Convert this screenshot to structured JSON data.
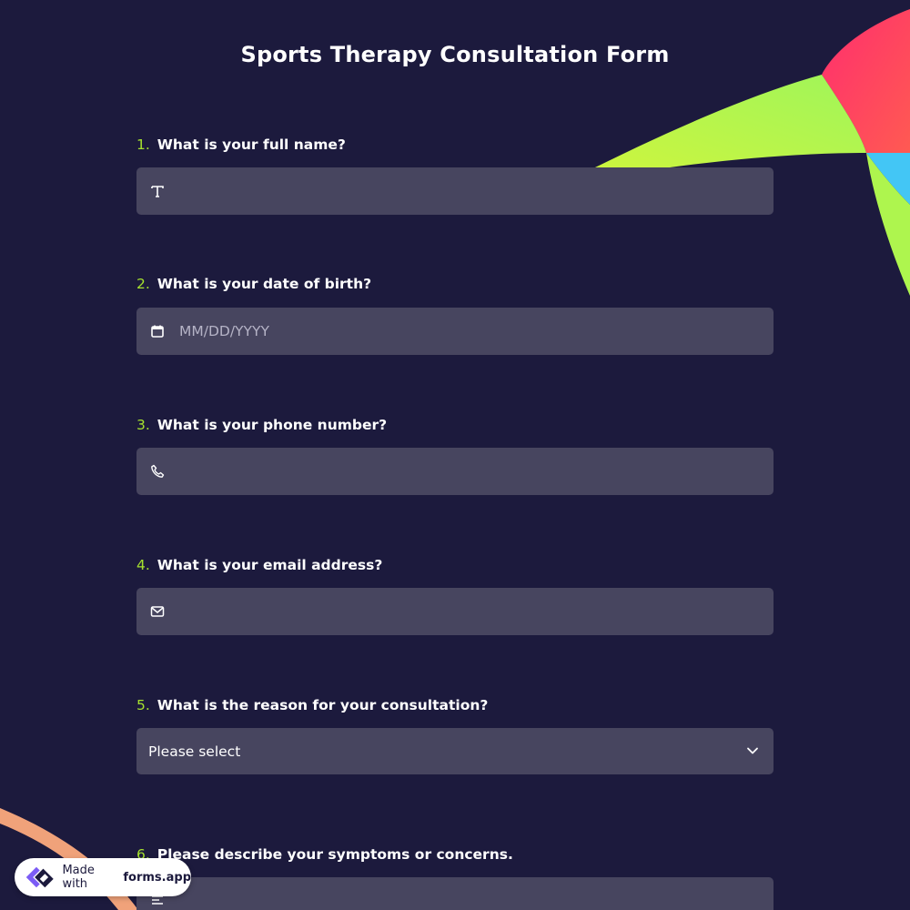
{
  "form": {
    "title": "Sports Therapy Consultation Form",
    "questions": [
      {
        "number": "1.",
        "label": "What is your full name?",
        "placeholder": "",
        "icon": "text-icon"
      },
      {
        "number": "2.",
        "label": "What is your date of birth?",
        "placeholder": "MM/DD/YYYY",
        "icon": "calendar-icon"
      },
      {
        "number": "3.",
        "label": "What is your phone number?",
        "placeholder": "",
        "icon": "phone-icon"
      },
      {
        "number": "4.",
        "label": "What is your email address?",
        "placeholder": "",
        "icon": "mail-icon"
      },
      {
        "number": "5.",
        "label": "What is the reason for your consultation?",
        "selected": "Please select",
        "icon": "chevron-down-icon"
      },
      {
        "number": "6.",
        "label": "Please describe your symptoms or concerns.",
        "placeholder": "",
        "icon": "text-lines-icon"
      }
    ]
  },
  "badge": {
    "made_with": "Made with",
    "brand": "forms.app"
  },
  "colors": {
    "background": "#1c1a3d",
    "field": "#47455f",
    "accent_number": "#a6e22e",
    "white": "#ffffff"
  }
}
